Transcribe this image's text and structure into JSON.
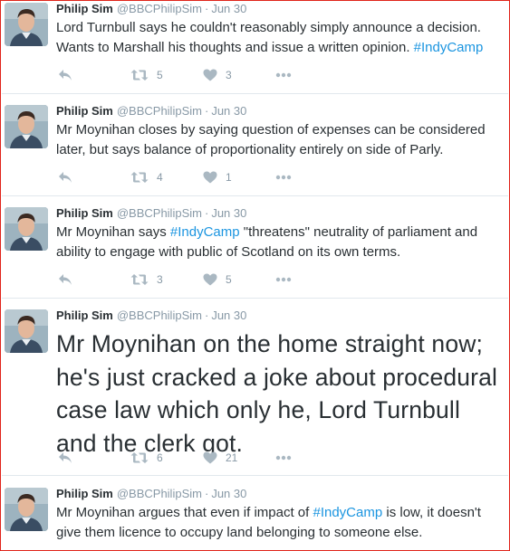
{
  "colors": {
    "name": "#292f33",
    "meta": "#8899a6",
    "hashtag": "#1b95e0",
    "icon": "#aab8c2",
    "frame_border": "#e0241a",
    "divider": "#e1e8ed"
  },
  "icons": {
    "reply": "reply-icon",
    "retweet": "retweet-icon",
    "like": "heart-icon",
    "more": "more-dots-icon"
  },
  "tweets": [
    {
      "name": "Philip Sim",
      "handle": "@BBCPhilipSim",
      "separator": "·",
      "time": "Jun 30",
      "text_before": "Lord Turnbull says he couldn't reasonably simply announce a decision. Wants to Marshall his thoughts and issue a written opinion. ",
      "hashtag": "#IndyCamp",
      "text_after": "",
      "retweets": "5",
      "likes": "3"
    },
    {
      "name": "Philip Sim",
      "handle": "@BBCPhilipSim",
      "separator": "·",
      "time": "Jun 30",
      "text_before": "Mr Moynihan closes by saying question of expenses can be considered later, but says balance of proportionality entirely on side of Parly.",
      "hashtag": "",
      "text_after": "",
      "retweets": "4",
      "likes": "1"
    },
    {
      "name": "Philip Sim",
      "handle": "@BBCPhilipSim",
      "separator": "·",
      "time": "Jun 30",
      "text_before": "Mr Moynihan says ",
      "hashtag": "#IndyCamp",
      "text_after": " \"threatens\" neutrality of parliament and ability to engage with public of Scotland on its own terms.",
      "retweets": "3",
      "likes": "5"
    },
    {
      "name": "Philip Sim",
      "handle": "@BBCPhilipSim",
      "separator": "·",
      "time": "Jun 30",
      "text_before": "Mr Moynihan on the home straight now; he's just cracked a joke about procedural case law which only he, Lord Turnbull and the clerk got.",
      "hashtag": "",
      "text_after": "",
      "retweets": "6",
      "likes": "21"
    },
    {
      "name": "Philip Sim",
      "handle": "@BBCPhilipSim",
      "separator": "·",
      "time": "Jun 30",
      "text_before": "Mr Moynihan argues that even if impact of ",
      "hashtag": "#IndyCamp",
      "text_after": " is low, it doesn't give them licence to occupy land belonging to someone else.",
      "retweets": "",
      "likes": ""
    }
  ]
}
